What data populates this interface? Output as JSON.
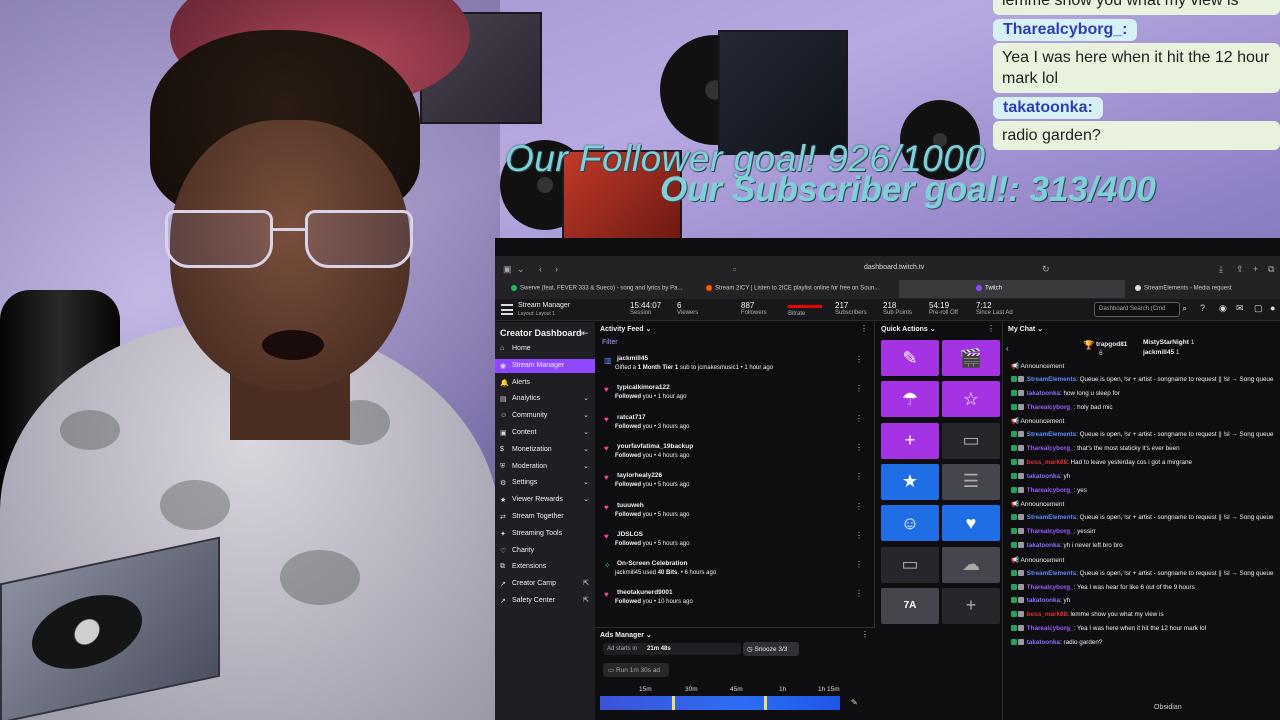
{
  "overlay": {
    "follower_goal": "Our Follower goal! 926/1000",
    "subscriber_goal": "Our Subscriber goal!: 313/400",
    "chat": [
      {
        "name": "",
        "text": "lemme show you what my view is"
      },
      {
        "name": "Tharealcyborg_:",
        "text": "Yea I was here when it hit the 12 hour mark lol"
      },
      {
        "name": "takatoonka:",
        "text": "radio garden?"
      }
    ]
  },
  "browser": {
    "url": "dashboard.twitch.tv",
    "tabs": [
      {
        "label": "Swerve (feat. FEVER 333 & Sueco) - song and lyrics by Pa...",
        "color": "#1db954"
      },
      {
        "label": "Stream 2ICY | Listen to 2ICE playlist online for free on Soun...",
        "color": "#ff5500"
      },
      {
        "label": "Twitch",
        "color": "#9147ff"
      },
      {
        "label": "StreamElements - Media request",
        "color": "#dddddd"
      }
    ]
  },
  "topbar": {
    "title": "Stream Manager",
    "layout": "Layout: Layout 1",
    "stats": [
      {
        "value": "15:44:07",
        "label": "Session"
      },
      {
        "value": "6",
        "label": "Viewers"
      },
      {
        "value": "887",
        "label": "Followers"
      },
      {
        "value": "",
        "label": "Bitrate"
      },
      {
        "value": "217",
        "label": "Subscribers"
      },
      {
        "value": "218",
        "label": "Sub Points"
      },
      {
        "value": "54:19",
        "label": "Pre-roll Off"
      },
      {
        "value": "7:12",
        "label": "Since Last Ad"
      }
    ],
    "search_placeholder": "Dashboard Search (Cmd"
  },
  "sidebar": {
    "title": "Creator Dashboard",
    "items": [
      {
        "label": "Home",
        "icon": "home-icon"
      },
      {
        "label": "Stream Manager",
        "icon": "broadcast-icon"
      },
      {
        "label": "Alerts",
        "icon": "bell-icon"
      },
      {
        "label": "Analytics",
        "icon": "analytics-icon"
      },
      {
        "label": "Community",
        "icon": "community-icon"
      },
      {
        "label": "Content",
        "icon": "content-icon"
      },
      {
        "label": "Monetization",
        "icon": "monetization-icon"
      },
      {
        "label": "Moderation",
        "icon": "moderation-icon"
      },
      {
        "label": "Settings",
        "icon": "settings-icon"
      },
      {
        "label": "Viewer Rewards",
        "icon": "rewards-icon"
      },
      {
        "label": "Stream Together",
        "icon": "stream-together-icon"
      },
      {
        "label": "Streaming Tools",
        "icon": "tools-icon"
      },
      {
        "label": "Charity",
        "icon": "charity-icon"
      },
      {
        "label": "Extensions",
        "icon": "extensions-icon"
      },
      {
        "label": "Creator Camp",
        "icon": "creator-camp-icon"
      },
      {
        "label": "Safety Center",
        "icon": "safety-icon"
      }
    ]
  },
  "activity": {
    "title": "Activity Feed",
    "filter": "Filter",
    "events": [
      {
        "name": "jackmill45",
        "desc_pre": "Gifted a ",
        "desc_bold": "1 Month Tier 1",
        "desc_post": " sub to jcmakesmusic1 • 1 hour ago",
        "icon": "gift-icon"
      },
      {
        "name": "typicalkimora122",
        "desc_pre": "",
        "desc_bold": "Followed",
        "desc_post": " you • 1 hour ago",
        "icon": "heart-icon"
      },
      {
        "name": "ratcat717",
        "desc_pre": "",
        "desc_bold": "Followed",
        "desc_post": " you • 3 hours ago",
        "icon": "heart-icon"
      },
      {
        "name": "yourfavfatima_19backup",
        "desc_pre": "",
        "desc_bold": "Followed",
        "desc_post": " you • 4 hours ago",
        "icon": "heart-icon"
      },
      {
        "name": "taylorhealy226",
        "desc_pre": "",
        "desc_bold": "Followed",
        "desc_post": " you • 5 hours ago",
        "icon": "heart-icon"
      },
      {
        "name": "tuuuweh",
        "desc_pre": "",
        "desc_bold": "Followed",
        "desc_post": " you • 5 hours ago",
        "icon": "heart-icon"
      },
      {
        "name": "JDSLOS",
        "desc_pre": "",
        "desc_bold": "Followed",
        "desc_post": " you • 5 hours ago",
        "icon": "heart-icon"
      },
      {
        "name": "On-Screen Celebration",
        "desc_pre": "jackmill45 used ",
        "desc_bold": "40 Bits",
        "desc_post": ". • 6 hours ago",
        "icon": "celebration-icon"
      },
      {
        "name": "theotakunerd9001",
        "desc_pre": "",
        "desc_bold": "Followed",
        "desc_post": " you • 10 hours ago",
        "icon": "heart-icon"
      }
    ]
  },
  "ads": {
    "title": "Ads Manager",
    "ad_starts_label": "Ad starts in",
    "ad_starts_value": "21m 48s",
    "snooze": "Snooze 3/3",
    "run_ad": "Run 1m 30s ad",
    "timeline_labels": [
      "15m",
      "30m",
      "45m",
      "1h",
      "1h 15m"
    ]
  },
  "quick_actions": {
    "title": "Quick Actions",
    "buttons": [
      {
        "icon": "pencil-icon",
        "glyph": "✎",
        "color": "purple"
      },
      {
        "icon": "clapper-icon",
        "glyph": "🎬",
        "color": "purple"
      },
      {
        "icon": "umbrella-icon",
        "glyph": "☂",
        "color": "purple"
      },
      {
        "icon": "star-outline-icon",
        "glyph": "☆",
        "color": "purple"
      },
      {
        "icon": "add-user-icon",
        "glyph": "+",
        "color": "purple"
      },
      {
        "icon": "camera-icon",
        "glyph": "▭",
        "color": "dark"
      },
      {
        "icon": "star-icon",
        "glyph": "★",
        "color": "blue"
      },
      {
        "icon": "log-icon",
        "glyph": "☰",
        "color": "gray"
      },
      {
        "icon": "smiley-icon",
        "glyph": "☺",
        "color": "blue"
      },
      {
        "icon": "heart-icon",
        "glyph": "♥",
        "color": "blue"
      },
      {
        "icon": "camera-icon",
        "glyph": "▭",
        "color": "dark"
      },
      {
        "icon": "cloud-icon",
        "glyph": "☁",
        "color": "gray"
      },
      {
        "icon": "translate-icon",
        "glyph": "7A",
        "color": "gray"
      },
      {
        "icon": "add-icon",
        "glyph": "+",
        "color": "dark"
      }
    ]
  },
  "chat": {
    "title": "My Chat",
    "pinned": [
      {
        "name": "trapgod81",
        "count": "6"
      },
      {
        "name": "MistyStarNight",
        "count": "1"
      },
      {
        "name": "jackmill45",
        "count": "1"
      }
    ],
    "lines": [
      {
        "type": "ann",
        "text": "Announcement"
      },
      {
        "type": "msg",
        "name": "StreamElements",
        "color": "#5d8bff",
        "text": ": Queue is open, !sr + artist - songname to request || !sl → Song queue",
        "wrap": true
      },
      {
        "type": "msg",
        "name": "takatoonka",
        "color": "#8a6cff",
        "text": ": how long u sleep for"
      },
      {
        "type": "msg",
        "name": "Tharealcyborg_",
        "color": "#9a5bff",
        "text": ": holy bad mic"
      },
      {
        "type": "ann",
        "text": "Announcement"
      },
      {
        "type": "msg",
        "name": "StreamElements",
        "color": "#5d8bff",
        "text": ": Queue is open, !sr + artist - songname to request || !sl → Song queue",
        "wrap": true
      },
      {
        "type": "msg",
        "name": "Tharealcyborg_",
        "color": "#9a5bff",
        "text": ": that's the most staticky it's ever been"
      },
      {
        "type": "msg",
        "name": "boss_mark88",
        "color": "#e0322e",
        "text": ": Had to leave yesterday cos i got a mirgrane"
      },
      {
        "type": "msg",
        "name": "takatoonka",
        "color": "#8a6cff",
        "text": ": yh"
      },
      {
        "type": "msg",
        "name": "Tharealcyborg_",
        "color": "#9a5bff",
        "text": ": yes"
      },
      {
        "type": "ann",
        "text": "Announcement"
      },
      {
        "type": "msg",
        "name": "StreamElements",
        "color": "#5d8bff",
        "text": ": Queue is open, !sr + artist - songname to request || !sl → Song queue",
        "wrap": true
      },
      {
        "type": "msg",
        "name": "Tharealcyborg_",
        "color": "#9a5bff",
        "text": ": yessirr"
      },
      {
        "type": "msg",
        "name": "takatoonka",
        "color": "#8a6cff",
        "text": ": yh i never left bro bro"
      },
      {
        "type": "ann",
        "text": "Announcement"
      },
      {
        "type": "msg",
        "name": "StreamElements",
        "color": "#5d8bff",
        "text": ": Queue is open, !sr + artist - songname to request || !sl → Song queue",
        "wrap": true
      },
      {
        "type": "msg",
        "name": "Tharealcyborg_",
        "color": "#9a5bff",
        "text": ": Yea I was hear for like 6 out of the 9 hours"
      },
      {
        "type": "msg",
        "name": "takatoonka",
        "color": "#8a6cff",
        "text": ": yh"
      },
      {
        "type": "msg",
        "name": "boss_mark88",
        "color": "#e0322e",
        "text": ": lemme show you what my view is"
      },
      {
        "type": "msg",
        "name": "Tharealcyborg_",
        "color": "#9a5bff",
        "text": ": Yea I was here when it hit the 12 hour mark lol"
      },
      {
        "type": "msg",
        "name": "takatoonka",
        "color": "#8a6cff",
        "text": ": radio garden?"
      }
    ],
    "overlay_label": "Obsidian"
  },
  "colors": {
    "twitch_purple": "#9147ff",
    "follow_heart": "#f545a0",
    "quick_purple": "#a434e3",
    "quick_blue": "#1f6ee6"
  }
}
